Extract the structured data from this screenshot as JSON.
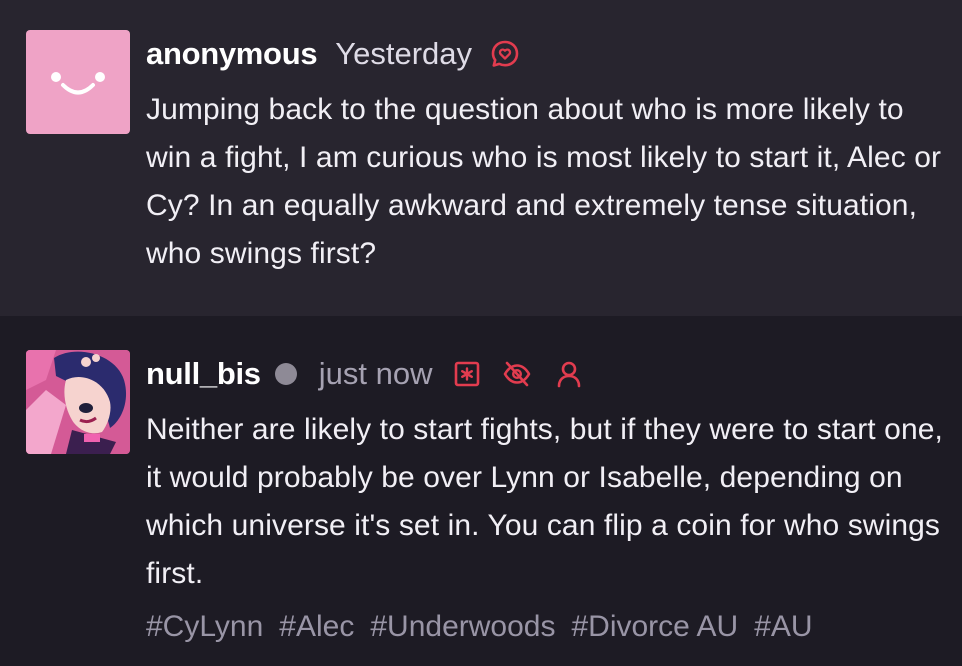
{
  "posts": {
    "question": {
      "username": "anonymous",
      "timestamp": "Yesterday",
      "icon": "speech-heart-icon",
      "body": "Jumping back to the question about who is more likely to win a fight, I am curious who is most likely to start it, Alec or Cy? In an equally awkward and extremely tense situation, who swings first?"
    },
    "answer": {
      "username": "null_bis",
      "status": "offline",
      "timestamp": "just now",
      "icons": [
        "asterisk-box-icon",
        "eye-slash-icon",
        "user-icon"
      ],
      "body": "Neither are likely to start fights, but if they were to start one, it would probably be over Lynn or Isabelle, depending on which universe it's set in. You can flip a coin for who swings first.",
      "tags": [
        "#CyLynn",
        "#Alec",
        "#Underwoods",
        "#Divorce AU",
        "#AU"
      ]
    }
  },
  "colors": {
    "accent": "#e23c4f",
    "question_bg": "#28252f",
    "answer_bg": "#1d1b24",
    "tag": "#9995a6"
  }
}
